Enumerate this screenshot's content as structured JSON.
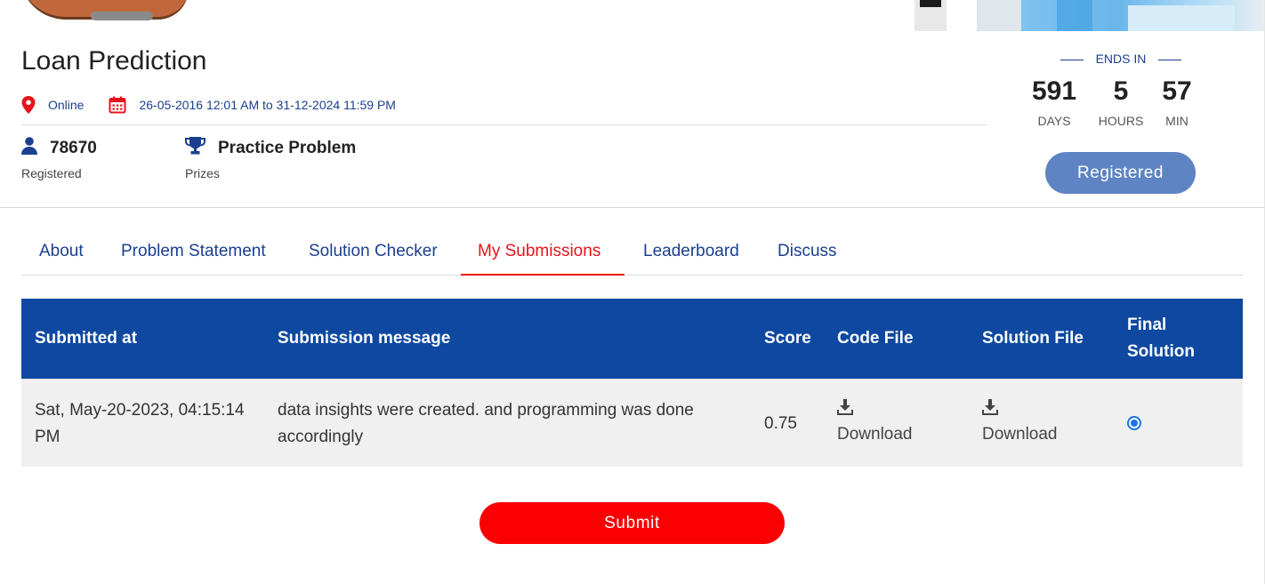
{
  "header": {
    "title": "Loan Prediction",
    "location": "Online",
    "dates": "26-05-2016 12:01 AM to 31-12-2024 11:59 PM",
    "registered_count": "78670",
    "registered_label": "Registered",
    "prize_value": "Practice Problem",
    "prize_label": "Prizes"
  },
  "countdown": {
    "label": "ENDS IN",
    "days": "591",
    "days_label": "DAYS",
    "hours": "5",
    "hours_label": "HOURS",
    "minutes": "57",
    "minutes_label": "MIN",
    "button_label": "Registered"
  },
  "tabs": {
    "about": "About",
    "problem_statement": "Problem Statement",
    "solution_checker": "Solution Checker",
    "my_submissions": "My Submissions",
    "leaderboard": "Leaderboard",
    "discuss": "Discuss"
  },
  "table": {
    "headers": {
      "submitted_at": "Submitted at",
      "message": "Submission message",
      "score": "Score",
      "code_file": "Code File",
      "solution_file": "Solution File",
      "final_solution_1": "Final",
      "final_solution_2": "Solution"
    },
    "rows": [
      {
        "submitted_at_1": "Sat, May-20-2023, 04:15:14",
        "submitted_at_2": "PM",
        "message_1": "data insights were created. and programming was done",
        "message_2": "accordingly",
        "score": "0.75",
        "code_file": "Download",
        "solution_file": "Download",
        "final_selected": true
      }
    ]
  },
  "submit_label": "Submit",
  "colors": {
    "brand_blue": "#0e48a0",
    "link_blue": "#1a3f8f",
    "accent_red": "#e8121b",
    "submit_red": "#fa0000",
    "registered_button": "#5f84c4"
  },
  "icons": {
    "location": "map-pin-icon",
    "calendar": "calendar-icon",
    "registered": "user-icon",
    "prizes": "trophy-icon",
    "download": "download-icon"
  }
}
